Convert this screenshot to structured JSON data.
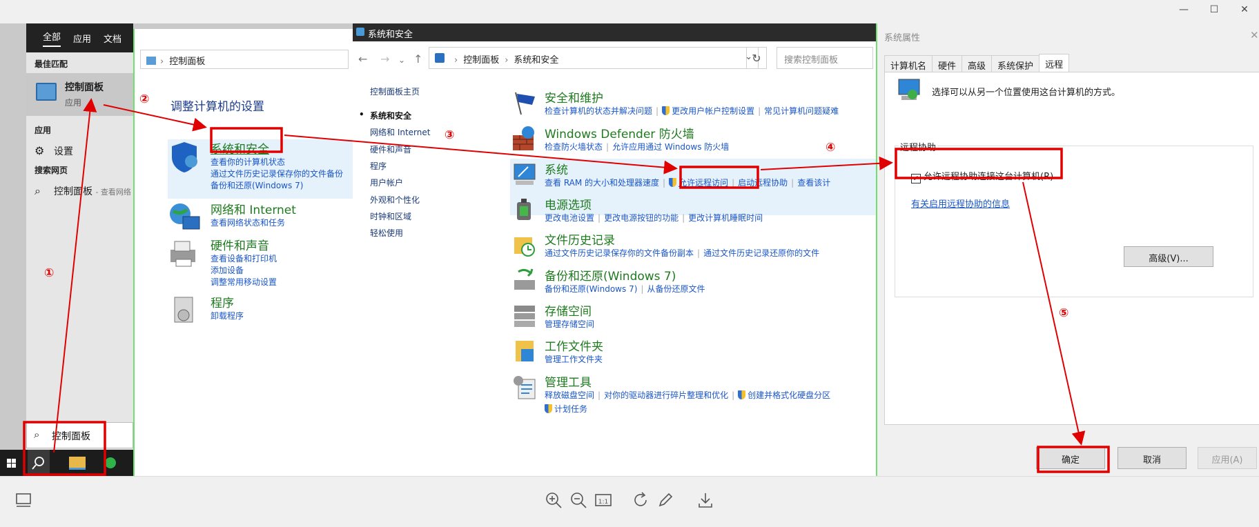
{
  "start_menu": {
    "tabs": [
      "全部",
      "应用",
      "文档"
    ],
    "best_match_header": "最佳匹配",
    "best_match": {
      "title": "控制面板",
      "subtitle": "应用"
    },
    "apps_header": "应用",
    "settings_item": "设置",
    "web_header": "搜索网页",
    "web_item": "控制面板",
    "web_item_suffix": "- 查看网络",
    "search_value": "控制面板"
  },
  "control_panel": {
    "address": "控制面板",
    "heading": "调整计算机的设置",
    "categories": [
      {
        "title": "系统和安全",
        "links": [
          "查看你的计算机状态",
          "通过文件历史记录保存你的文件备份",
          "备份和还原(Windows 7)"
        ]
      },
      {
        "title": "网络和 Internet",
        "links": [
          "查看网络状态和任务"
        ]
      },
      {
        "title": "硬件和声音",
        "links": [
          "查看设备和打印机",
          "添加设备",
          "调整常用移动设置"
        ]
      },
      {
        "title": "程序",
        "links": [
          "卸载程序"
        ]
      }
    ]
  },
  "system_security": {
    "window_title": "系统和安全",
    "breadcrumb": [
      "控制面板",
      "系统和安全"
    ],
    "search_placeholder": "搜索控制面板",
    "sidebar": [
      "控制面板主页",
      "系统和安全",
      "网络和 Internet",
      "硬件和声音",
      "程序",
      "用户帐户",
      "外观和个性化",
      "时钟和区域",
      "轻松使用"
    ],
    "sections": [
      {
        "title": "安全和维护",
        "links": [
          "检查计算机的状态并解决问题",
          "更改用户帐户控制设置",
          "常见计算机问题疑难"
        ]
      },
      {
        "title": "Windows Defender 防火墙",
        "links": [
          "检查防火墙状态",
          "允许应用通过 Windows 防火墙"
        ]
      },
      {
        "title": "系统",
        "links": [
          "查看 RAM 的大小和处理器速度",
          "允许远程访问",
          "启动远程协助",
          "查看该计"
        ]
      },
      {
        "title": "电源选项",
        "links": [
          "更改电池设置",
          "更改电源按钮的功能",
          "更改计算机睡眠时间"
        ]
      },
      {
        "title": "文件历史记录",
        "links": [
          "通过文件历史记录保存你的文件备份副本",
          "通过文件历史记录还原你的文件"
        ]
      },
      {
        "title": "备份和还原(Windows 7)",
        "links": [
          "备份和还原(Windows 7)",
          "从备份还原文件"
        ]
      },
      {
        "title": "存储空间",
        "links": [
          "管理存储空间"
        ]
      },
      {
        "title": "工作文件夹",
        "links": [
          "管理工作文件夹"
        ]
      },
      {
        "title": "管理工具",
        "links": [
          "释放磁盘空间",
          "对你的驱动器进行碎片整理和优化",
          "创建并格式化硬盘分区",
          "计划任务"
        ]
      }
    ]
  },
  "system_properties": {
    "title": "系统属性",
    "tabs": [
      "计算机名",
      "硬件",
      "高级",
      "系统保护",
      "远程"
    ],
    "description": "选择可以从另一个位置使用这台计算机的方式。",
    "group_label": "远程协助",
    "checkbox_label": "允许远程协助连接这台计算机(R)",
    "info_link": "有关启用远程协助的信息",
    "advanced_button": "高级(V)...",
    "ok_button": "确定",
    "cancel_button": "取消",
    "apply_button": "应用(A)"
  },
  "annotations": {
    "steps": [
      "①",
      "②",
      "③",
      "④",
      "⑤"
    ]
  },
  "colors": {
    "annotation": "#e00000",
    "link": "#1a56c8",
    "category": "#1e7a1e",
    "selection": "#e5f1fb"
  }
}
